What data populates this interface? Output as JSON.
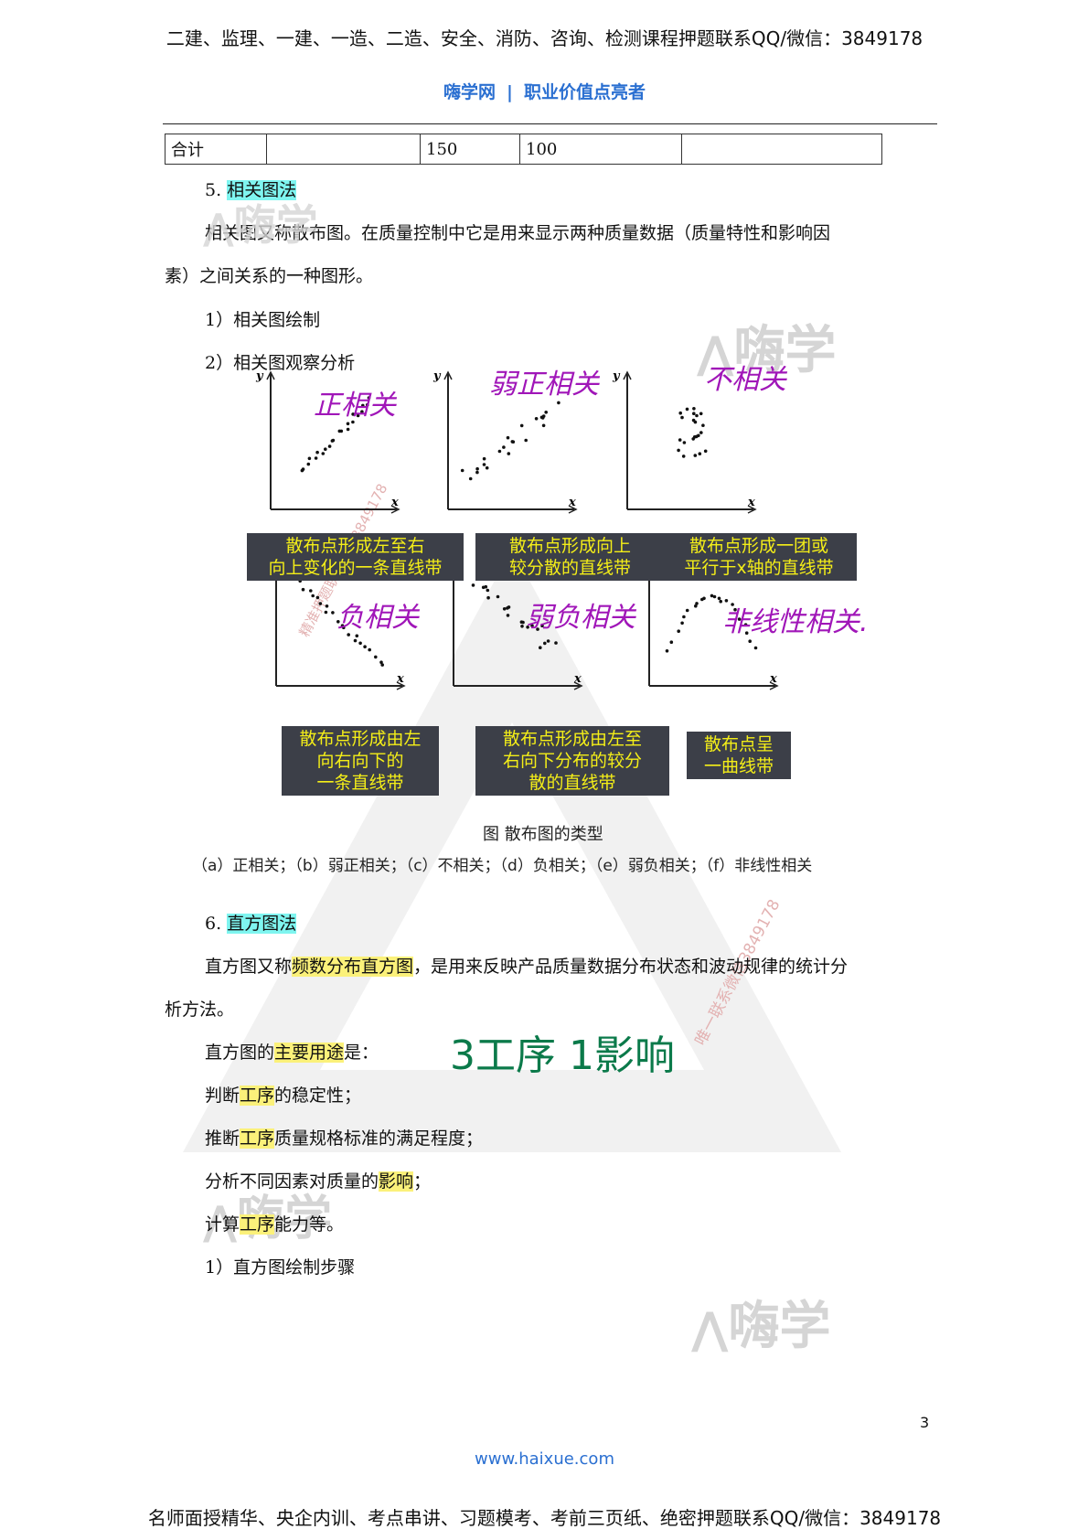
{
  "header": {
    "top_line": "二建、监理、一建、一造、二造、安全、消防、咨询、检测课程押题联系QQ/微信：3849178",
    "brand": "嗨学网",
    "separator": "|",
    "slogan": "职业价值点亮者"
  },
  "total_row": [
    "合计",
    "",
    "150",
    "100",
    ""
  ],
  "section5": {
    "number": "5.",
    "title": "相关图法",
    "intro": "相关图又称散布图。在质量控制中它是用来显示两种质量数据（质量特性和影响因",
    "intro_cont": "素）之间关系的一种图形。",
    "step1": "1）相关图绘制",
    "step2": "2）相关图观察分析"
  },
  "figure": {
    "y_label": "y",
    "x_label": "x",
    "panels": [
      {
        "handwritten": "正相关",
        "caption": [
          "散布点形成左至右",
          "向上变化的一条直线带"
        ]
      },
      {
        "handwritten": "弱正相关",
        "caption": [
          "散布点形成向上",
          "较分散的直线带"
        ]
      },
      {
        "handwritten": "不相关",
        "caption": [
          "散布点形成一团或",
          "平行于x轴的直线带"
        ]
      },
      {
        "handwritten": "负相关",
        "caption": [
          "散布点形成由左",
          "向右向下的",
          "一条直线带"
        ]
      },
      {
        "handwritten": "弱负相关",
        "caption": [
          "散布点形成由左至",
          "右向下分布的较分",
          "散的直线带"
        ]
      },
      {
        "handwritten": "非线性相关.",
        "caption": [
          "散布点呈",
          "一曲线带"
        ]
      }
    ],
    "title": "图  散布图的类型",
    "legend": "（a）正相关；（b）弱正相关；（c）不相关；（d）负相关；（e）弱负相关；（f）非线性相关"
  },
  "section6": {
    "number": "6.",
    "title": "直方图法",
    "def_pre": "直方图又称",
    "def_hl": "频数分布直方图",
    "def_post": "，是用来反映产品质量数据分布状态和波动规律的统计分",
    "def_cont": "析方法。",
    "use_pre": "直方图的",
    "use_hl": "主要用途",
    "use_post": "是：",
    "note": "3工序 1影响",
    "item1_pre": "判断",
    "item1_hl": "工序",
    "item1_post": "的稳定性；",
    "item2_pre": "推断",
    "item2_hl": "工序",
    "item2_post": "质量规格标准的满足程度；",
    "item3_pre": "分析不同因素对质量的",
    "item3_hl": "影响",
    "item3_post": "；",
    "item4_pre": "计算",
    "item4_hl": "工序",
    "item4_post": "能力等。",
    "step1": "1）直方图绘制步骤"
  },
  "watermarks": {
    "logo_text": "嗨学",
    "diag1": "精准押题联系微信3849178",
    "diag2": "唯一联系微信3849178"
  },
  "footer": {
    "page_number": "3",
    "url": "www.haixue.com",
    "bottom_line": "名师面授精华、央企内训、考点串讲、习题模考、考前三页纸、绝密押题联系QQ/微信：3849178"
  },
  "colors": {
    "brand_blue": "#2a6fd1",
    "highlight_cyan": "#7ff5f0",
    "highlight_yellow": "#fbf17a",
    "caption_bg": "#3c3f48",
    "caption_text": "#f4ee18",
    "pen_purple": "#a016b8",
    "pen_green": "#0b7a4a"
  }
}
